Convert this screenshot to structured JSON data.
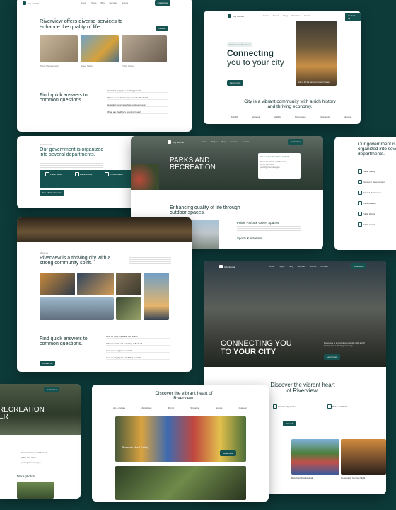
{
  "brand": {
    "logo_text": "City Journal",
    "accent": "#16524f",
    "background": "#0d3b3a"
  },
  "nav_items": [
    "Home",
    "Pages",
    "Blog",
    "Services",
    "Events",
    "Contact"
  ],
  "cta_label": "Contact us",
  "card_services": {
    "title": "Riverview offers diverse services to enhance the quality of life.",
    "button": "View all",
    "items": [
      "Waste Management",
      "Street Safety",
      "Public Works"
    ],
    "faq_title": "Find quick answers to common questions.",
    "faq_items": [
      "How do I apply for a parking permit?",
      "Where can I find the city council schedule?",
      "How do I report a pothole or street issue?",
      "What are the library opening hours?"
    ]
  },
  "card_hero": {
    "tag": "Welcome to Riverview",
    "title_line1": "Connecting",
    "title_line2": "you to your city",
    "button": "Learn more",
    "image_caption": "Join us for the Summer Concert Series",
    "tagline": "City is a vibrant community with a rich history and thriving economy.",
    "partners": [
      "Brandify",
      "Vortexia",
      "Scaffold",
      "Bloomwave",
      "Quantumly",
      "Nexora"
    ]
  },
  "card_departments": {
    "tag": "Departments",
    "title": "Our government is organized into several departments.",
    "items": [
      "Public Safety",
      "Public Works",
      "Transportation"
    ],
    "button": "See all departments"
  },
  "card_parks": {
    "title_line1": "PARKS AND",
    "title_line2": "RECREATION",
    "contact_title": "Have a question about parks?",
    "contacts": [
      "Riverside Park, 123 Main St",
      "(555) 123-4567",
      "parks@riverview.gov"
    ],
    "subtitle": "Enhancing quality of life through outdoor spaces.",
    "section1": "Public Parks & Green Spaces",
    "section2": "Sports & Athletics"
  },
  "card_dept_right": {
    "title": "Our government is organized into several departments.",
    "items": [
      "Public Safety",
      "Economic Development",
      "Parks & Recreation",
      "Transportation",
      "Public Works",
      "Public Library"
    ]
  },
  "card_community": {
    "tag": "About us",
    "title": "Riverview is a thriving city with a strong community spirit.",
    "faq_title": "Find quick answers to common questions.",
    "faq_items": [
      "How do I pay my water bill online?",
      "When is trash and recycling collected?",
      "How can I register to vote?",
      "How do I apply for a building permit?"
    ],
    "button": "Contact us"
  },
  "card_connecting_dark": {
    "title_line1": "CONNECTING YOU",
    "title_line2": "TO ",
    "title_highlight": "YOUR CITY",
    "blurb": "Riverview is a vibrant community with a rich history and a thriving economy.",
    "button": "Learn more",
    "discover_title": "Discover the vibrant heart of Riverview.",
    "links": [
      "Historic City Center",
      "Parks and Trails"
    ],
    "gallery_caption_1": "Riverfront Arts Festival",
    "gallery_caption_2": "Community Concert Night",
    "button2": "View all"
  },
  "card_recreation_left": {
    "title_line1": "RECREATION",
    "title_line2": "ER",
    "items": [
      "Riverside Park, 123 Main St",
      "(555) 123-4567",
      "parks@riverview.gov"
    ],
    "more_photos": "More photos"
  },
  "card_discover": {
    "title": "Discover the vibrant heart of Riverview.",
    "tabs": [
      "Art & Culture",
      "Attractions",
      "Dining",
      "Shopping",
      "Events",
      "Outdoors"
    ],
    "feature_title": "Riverwalk Mural Gallery",
    "feature_button": "Read more"
  }
}
